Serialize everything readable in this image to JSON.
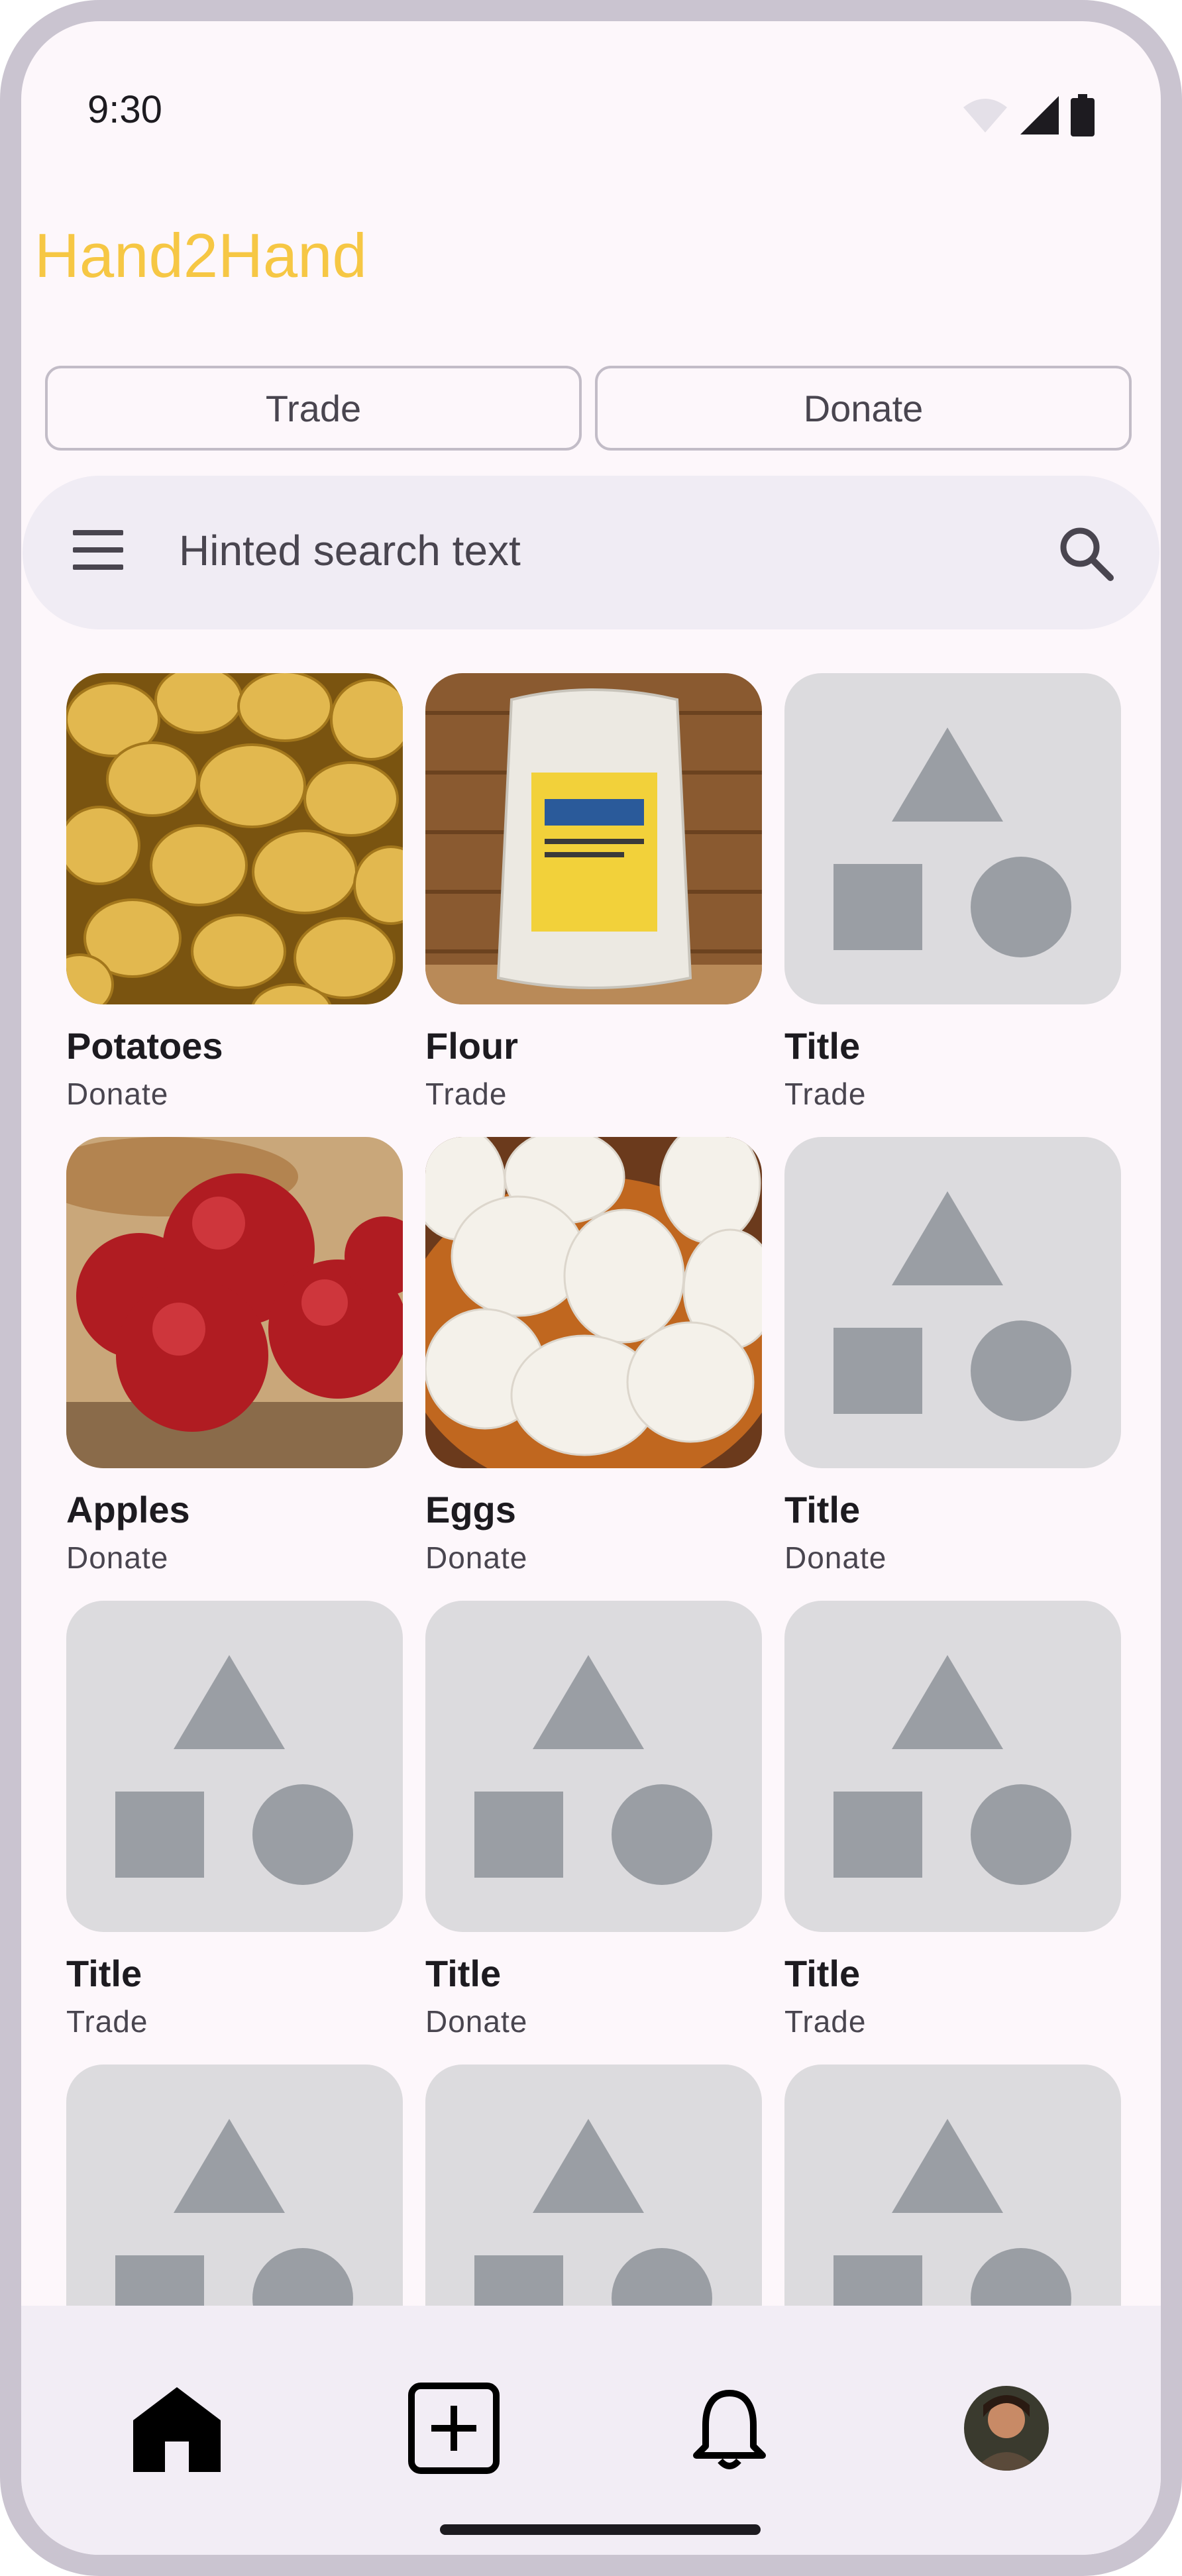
{
  "status_bar": {
    "time": "9:30"
  },
  "app": {
    "title": "Hand2Hand",
    "brand_color": "#f6c744"
  },
  "segments": {
    "trade_label": "Trade",
    "donate_label": "Donate"
  },
  "search": {
    "placeholder": "Hinted search text",
    "leading_icon": "menu-icon",
    "trailing_icon": "search-icon"
  },
  "items": [
    {
      "title": "Potatoes",
      "type": "Donate",
      "image": "potatoes"
    },
    {
      "title": "Flour",
      "type": "Trade",
      "image": "flour"
    },
    {
      "title": "Title",
      "type": "Trade",
      "image": "placeholder"
    },
    {
      "title": "Apples",
      "type": "Donate",
      "image": "apples"
    },
    {
      "title": "Eggs",
      "type": "Donate",
      "image": "eggs"
    },
    {
      "title": "Title",
      "type": "Donate",
      "image": "placeholder"
    },
    {
      "title": "Title",
      "type": "Trade",
      "image": "placeholder"
    },
    {
      "title": "Title",
      "type": "Donate",
      "image": "placeholder"
    },
    {
      "title": "Title",
      "type": "Trade",
      "image": "placeholder"
    },
    {
      "title": "",
      "type": "",
      "image": "placeholder"
    },
    {
      "title": "",
      "type": "",
      "image": "placeholder"
    },
    {
      "title": "",
      "type": "",
      "image": "placeholder"
    }
  ],
  "nav": {
    "items": [
      {
        "icon": "home-icon",
        "selected": true
      },
      {
        "icon": "add-box-icon",
        "selected": false
      },
      {
        "icon": "bell-icon",
        "selected": false
      },
      {
        "icon": "avatar",
        "selected": false
      }
    ]
  }
}
